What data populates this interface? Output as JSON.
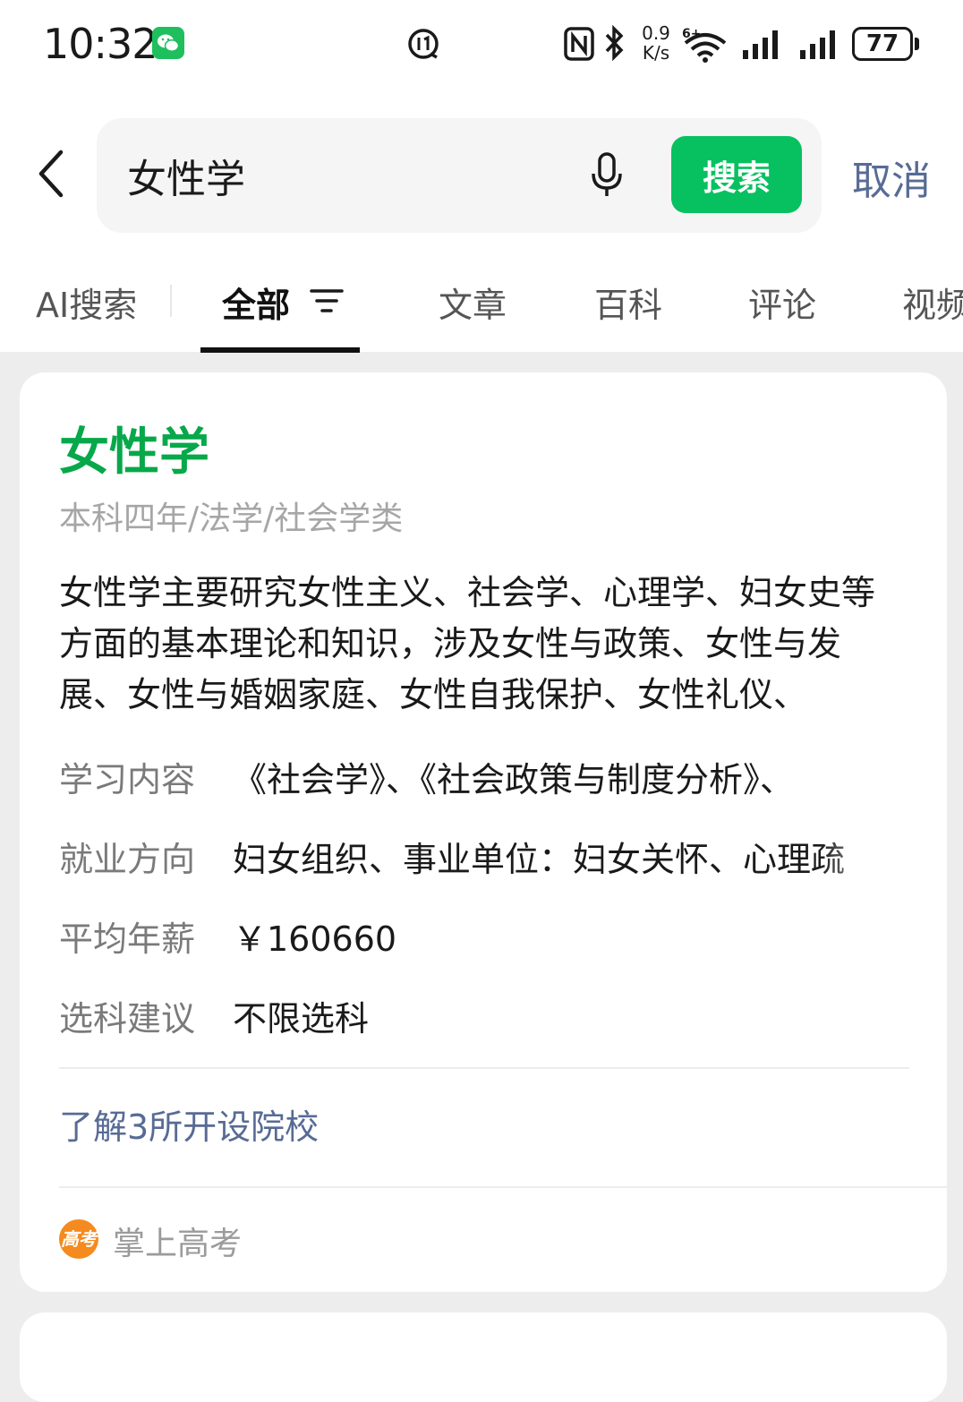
{
  "status_bar": {
    "time": "10:32",
    "speed_top": "0.9",
    "speed_bottom": "K/s",
    "wifi_label": "6+",
    "battery": "77"
  },
  "search": {
    "query": "女性学",
    "button_label": "搜索",
    "cancel_label": "取消"
  },
  "tabs": [
    {
      "label": "AI搜索"
    },
    {
      "label": "全部"
    },
    {
      "label": "文章"
    },
    {
      "label": "百科"
    },
    {
      "label": "评论"
    },
    {
      "label": "视频"
    }
  ],
  "card": {
    "title": "女性学",
    "subtitle": "本科四年/法学/社会学类",
    "description": "女性学主要研究女性主义、社会学、心理学、妇女史等方面的基本理论和知识，涉及女性与政策、女性与发展、女性与婚姻家庭、女性自我保护、女性礼仪、",
    "rows": [
      {
        "label": "学习内容",
        "value": "《社会学》、《社会政策与制度分析》、"
      },
      {
        "label": "就业方向",
        "value": "妇女组织、事业单位：妇女关怀、心理疏"
      },
      {
        "label": "平均年薪",
        "value": "￥160660"
      },
      {
        "label": "选科建议",
        "value": "不限选科"
      }
    ],
    "link": "了解3所开设院校",
    "source_logo": "高考",
    "source_name": "掌上高考"
  },
  "colors": {
    "accent_green": "#07c160",
    "title_green": "#07a84a",
    "link_blue": "#576b95"
  }
}
